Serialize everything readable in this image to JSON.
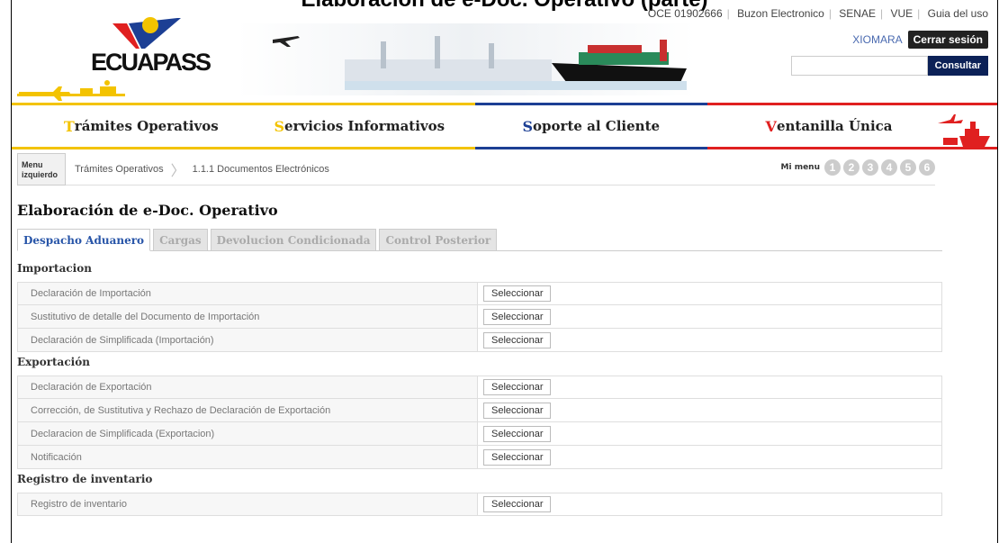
{
  "header": {
    "top_title": "Elaboración de e-Doc. Operativo (parte)",
    "logo_text": "ECUAPASS",
    "links": [
      "OCE 01902666",
      "Buzon Electronico",
      "SENAE",
      "VUE",
      "Guia del uso"
    ],
    "username": "XIOMARA",
    "logout_label": "Cerrar sesión",
    "search_button": "Consultar",
    "search_value": ""
  },
  "nav": {
    "items": [
      {
        "first": "T",
        "rest": "rámites Operativos"
      },
      {
        "first": "S",
        "rest": "ervicios Informativos"
      },
      {
        "first": "S",
        "rest": "oporte al Cliente"
      },
      {
        "first": "V",
        "rest": "entanilla Única"
      }
    ]
  },
  "breadcrumb": {
    "menu_label_1": "Menu",
    "menu_label_2": "izquierdo",
    "path_1": "Trámites Operativos",
    "path_2": "1.1.1 Documentos Electrónicos",
    "mymenu_label": "Mi menu",
    "mymenu_numbers": [
      "1",
      "2",
      "3",
      "4",
      "5",
      "6"
    ]
  },
  "page": {
    "title": "Elaboración de e-Doc. Operativo",
    "tabs": [
      "Despacho Aduanero",
      "Cargas",
      "Devolucion Condicionada",
      "Control Posterior"
    ]
  },
  "sections": {
    "importacion": {
      "label": "Importacion",
      "rows": [
        "Declaración de Importación",
        "Sustitutivo de detalle del Documento de Importación",
        "Declaración de Simplificada (Importación)"
      ]
    },
    "exportacion": {
      "label": "Exportación",
      "rows": [
        "Declaración de Exportación",
        "Corrección, de Sustitutiva y Rechazo de Declaración de Exportación",
        "Declaracion de Simplificada (Exportacion)",
        "Notificación"
      ]
    },
    "inventario": {
      "label": "Registro de inventario",
      "rows": [
        "Registro de inventario"
      ]
    }
  },
  "select_label": "Seleccionar"
}
